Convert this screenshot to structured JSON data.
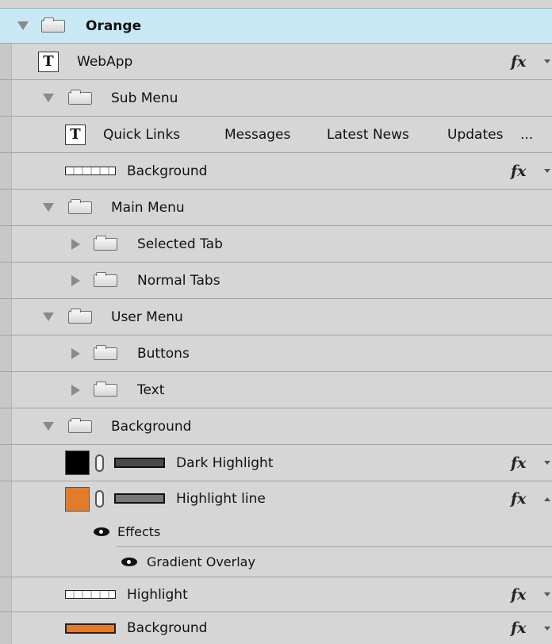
{
  "layers_panel": {
    "orange_group": {
      "label": "Orange",
      "expander": "triangle-down-icon",
      "icon": "folder-icon"
    },
    "webapp": {
      "label": "WebApp",
      "icon": "text-layer-icon",
      "fx": "fx"
    },
    "sub_menu": {
      "label": "Sub Menu"
    },
    "quick_links_text": {
      "labels": [
        "Quick Links",
        "Messages",
        "Latest News",
        "Updates",
        "..."
      ]
    },
    "sub_menu_background": {
      "label": "Background",
      "fx": "fx"
    },
    "main_menu": {
      "label": "Main Menu"
    },
    "selected_tab": {
      "label": "Selected Tab"
    },
    "normal_tabs": {
      "label": "Normal Tabs"
    },
    "user_menu": {
      "label": "User Menu"
    },
    "buttons": {
      "label": "Buttons"
    },
    "text_group": {
      "label": "Text"
    },
    "background_group": {
      "label": "Background"
    },
    "dark_highlight": {
      "label": "Dark Highlight",
      "fx": "fx",
      "swatch_color": "#000000"
    },
    "highlight_line": {
      "label": "Highlight line",
      "fx": "fx",
      "swatch_color": "#e27c2a"
    },
    "effects": {
      "label": "Effects"
    },
    "gradient_overlay": {
      "label": "Gradient Overlay"
    },
    "highlight": {
      "label": "Highlight",
      "fx": "fx"
    },
    "background_layer": {
      "label": "Background",
      "fx": "fx"
    }
  },
  "colors": {
    "selected_row": "#c9e8f5",
    "row": "#d6d6d6",
    "accent_orange": "#e27c2a"
  }
}
